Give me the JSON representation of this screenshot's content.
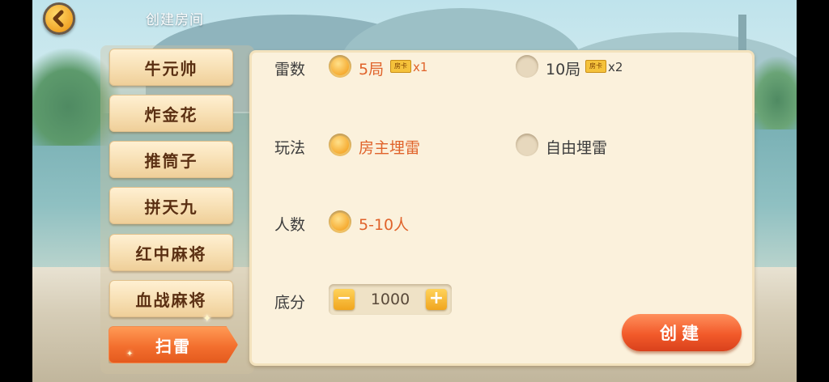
{
  "header": {
    "title": "创建房间"
  },
  "tabs": [
    {
      "label": "牛元帅",
      "active": false
    },
    {
      "label": "炸金花",
      "active": false
    },
    {
      "label": "推筒子",
      "active": false
    },
    {
      "label": "拼天九",
      "active": false
    },
    {
      "label": "红中麻将",
      "active": false
    },
    {
      "label": "血战麻将",
      "active": false
    },
    {
      "label": "扫雷",
      "active": true
    }
  ],
  "settings": {
    "rounds": {
      "label": "雷数",
      "options": [
        {
          "text": "5局",
          "card_text": "房卡",
          "multiplier": "x1",
          "selected": true
        },
        {
          "text": "10局",
          "card_text": "房卡",
          "multiplier": "x2",
          "selected": false
        }
      ]
    },
    "mode": {
      "label": "玩法",
      "options": [
        {
          "text": "房主埋雷",
          "selected": true
        },
        {
          "text": "自由埋雷",
          "selected": false
        }
      ]
    },
    "players": {
      "label": "人数",
      "options": [
        {
          "text": "5-10人",
          "selected": true
        }
      ]
    },
    "base_score": {
      "label": "底分",
      "value": "1000",
      "minus": "−",
      "plus": "+"
    }
  },
  "create_button": {
    "label": "创建"
  },
  "colors": {
    "accent": "#f25a2a",
    "selected_text": "#e0632b",
    "panel": "#fbf1dc"
  }
}
